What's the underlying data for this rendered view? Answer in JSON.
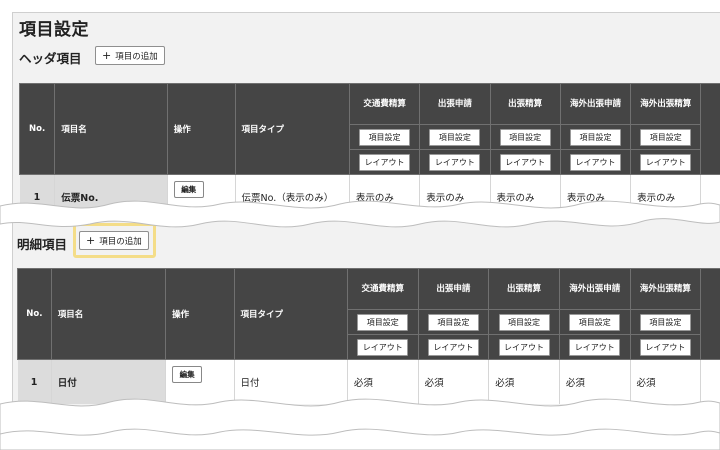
{
  "page": {
    "title": "項目設定"
  },
  "header_section": {
    "label": "ヘッダ項目",
    "add_button": "項目の追加"
  },
  "detail_section": {
    "label": "明細項目",
    "add_button": "項目の追加"
  },
  "table": {
    "columns": {
      "no": "No.",
      "name": "項目名",
      "operation": "操作",
      "type": "項目タイプ"
    },
    "form_types": [
      "交通費精算",
      "出張申請",
      "出張精算",
      "海外出張申請",
      "海外出張精算"
    ],
    "settings_button": "項目設定",
    "layout_button": "レイアウト",
    "edit_button": "編集"
  },
  "header_rows": [
    {
      "no": "1",
      "name": "伝票No.",
      "type": "伝票No.（表示のみ）",
      "values": [
        "表示のみ",
        "表示のみ",
        "表示のみ",
        "表示のみ",
        "表示のみ"
      ]
    }
  ],
  "detail_rows": [
    {
      "no": "1",
      "name": "日付",
      "type": "日付",
      "values": [
        "必須",
        "必須",
        "必須",
        "必須",
        "必須"
      ]
    }
  ],
  "colors": {
    "header_bg": "#454545",
    "panel_bg": "#f2f2f2",
    "highlight": "#f4dd88",
    "row_gray": "#dcdcdc"
  }
}
